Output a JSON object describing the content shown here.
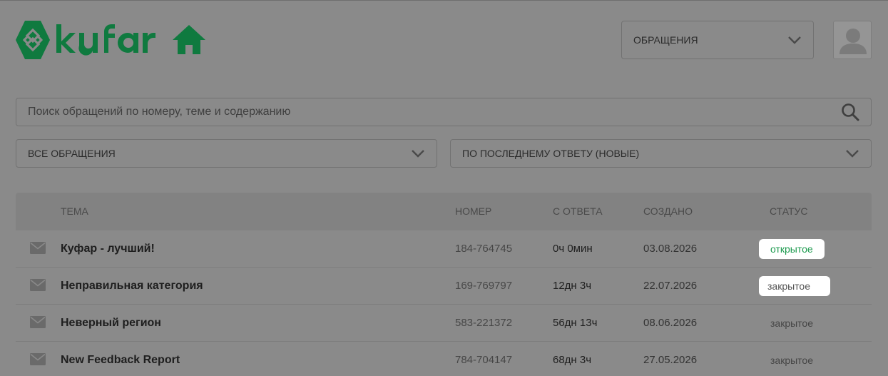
{
  "brand": {
    "logo_text": "kufar",
    "accent": "#0f7a3f"
  },
  "header": {
    "section_select": {
      "value": "ОБРАЩЕНИЯ",
      "icon": "chevron-down-icon"
    },
    "home_icon": "home-icon",
    "avatar_icon": "user-silhouette-icon"
  },
  "search": {
    "placeholder": "Поиск обращений по номеру, теме и содержанию",
    "value": "",
    "icon": "search-icon"
  },
  "filters": {
    "type": {
      "value": "ВСЕ ОБРАЩЕНИЯ"
    },
    "sort": {
      "value": "ПО ПОСЛЕДНЕМУ ОТВЕТУ (НОВЫЕ)"
    }
  },
  "table": {
    "columns": {
      "subject": "ТЕМА",
      "number": "НОМЕР",
      "since": "С ОТВЕТА",
      "created": "СОЗДАНО",
      "status": "СТАТУС"
    },
    "rows": [
      {
        "subject": "Куфар - лучший!",
        "number": "184-764745",
        "since": "0ч 0мин",
        "created": "03.08.2026",
        "status": "открытое"
      },
      {
        "subject": "Неправильная категория",
        "number": "169-769797",
        "since": "12дн 3ч",
        "created": "22.07.2026",
        "status": "закрытое"
      },
      {
        "subject": "Неверный регион",
        "number": "583-221372",
        "since": "56дн 13ч",
        "created": "08.06.2026",
        "status": "закрытое"
      },
      {
        "subject": "New Feedback Report",
        "number": "784-704147",
        "since": "68дн 3ч",
        "created": "27.05.2026",
        "status": "закрытое"
      }
    ]
  },
  "colors": {
    "status_open": "#1c9a4e",
    "status_closed": "#555555",
    "overlay": "#8a8a8a"
  }
}
